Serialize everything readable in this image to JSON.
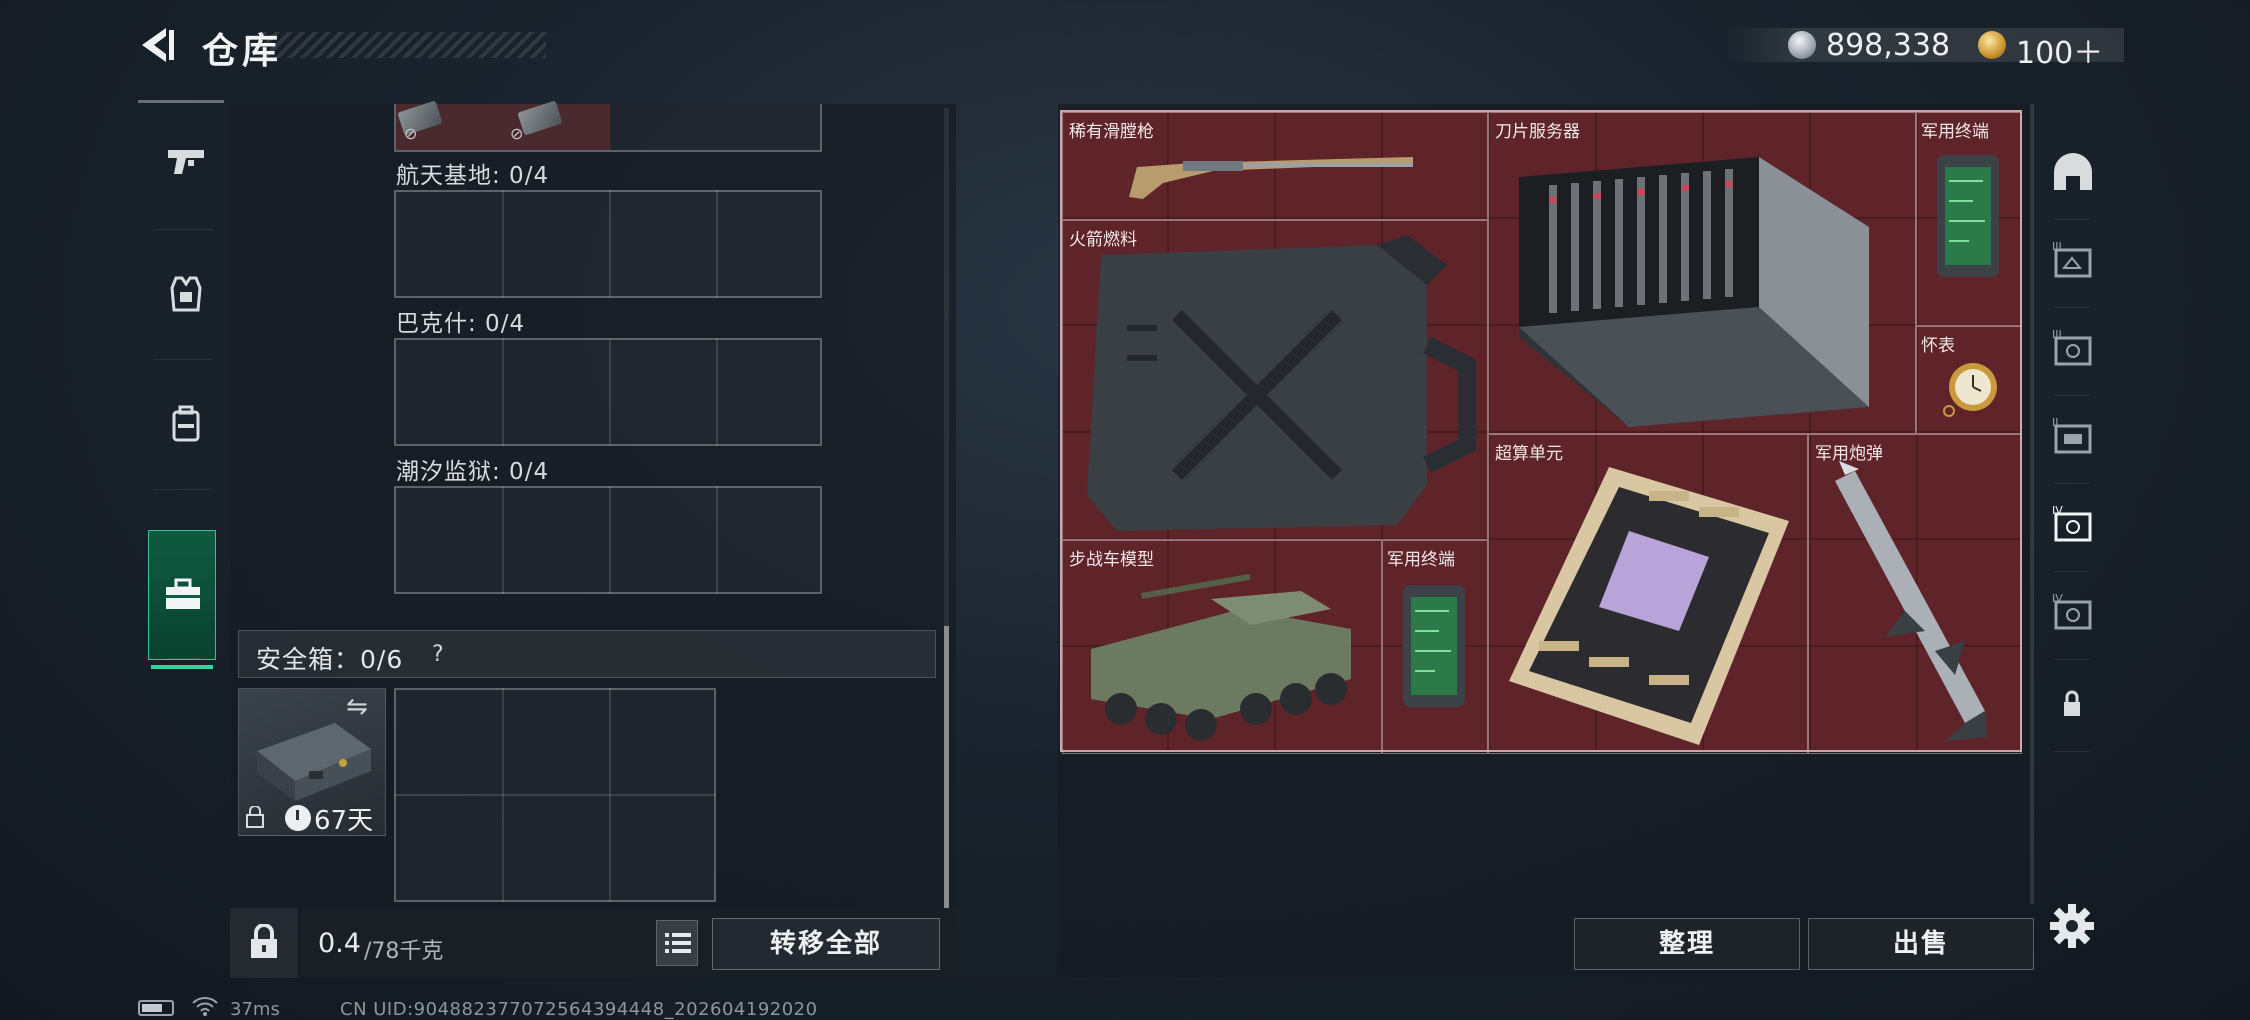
{
  "header": {
    "title": "仓库",
    "money": "898,338",
    "gold": "100＋"
  },
  "left_nav": [
    {
      "icon": "pistol-icon"
    },
    {
      "icon": "armor-vest-icon"
    },
    {
      "icon": "backpack-icon"
    },
    {
      "icon": "briefcase-icon",
      "active": true
    }
  ],
  "containers": [
    {
      "label": "航天基地: 0/4"
    },
    {
      "label": "巴克什: 0/4"
    },
    {
      "label": "潮汐监狱: 0/4"
    }
  ],
  "safe_box": {
    "label": "安全箱：0/6",
    "help": "?",
    "days": "67天"
  },
  "weight": {
    "current": "0.4",
    "max": "/78千克"
  },
  "buttons": {
    "transfer_all": "转移全部",
    "sort": "整理",
    "sell": "出售"
  },
  "stash_items": [
    {
      "label": "稀有滑膛枪"
    },
    {
      "label": "刀片服务器"
    },
    {
      "label": "军用终端"
    },
    {
      "label": "火箭燃料"
    },
    {
      "label": "怀表"
    },
    {
      "label": "超算单元"
    },
    {
      "label": "军用炮弹"
    },
    {
      "label": "步战车模型"
    },
    {
      "label": "军用终端"
    }
  ],
  "right_nav": [
    {
      "icon": "helmet-icon"
    },
    {
      "icon": "tier-3-box-icon"
    },
    {
      "icon": "tier-3-box-alt-icon"
    },
    {
      "icon": "tier-2-box-icon"
    },
    {
      "icon": "tier-4-box-active-icon",
      "active": true
    },
    {
      "icon": "tier-4-box-icon"
    },
    {
      "icon": "lock-icon"
    }
  ],
  "status": {
    "ping": "37ms",
    "uid": "CN UID:904882377072564394448_202604192020"
  },
  "colors": {
    "stash_bg": "#5e2429",
    "active_tab": "#0f5a40",
    "active_accent": "#2fd59a"
  }
}
